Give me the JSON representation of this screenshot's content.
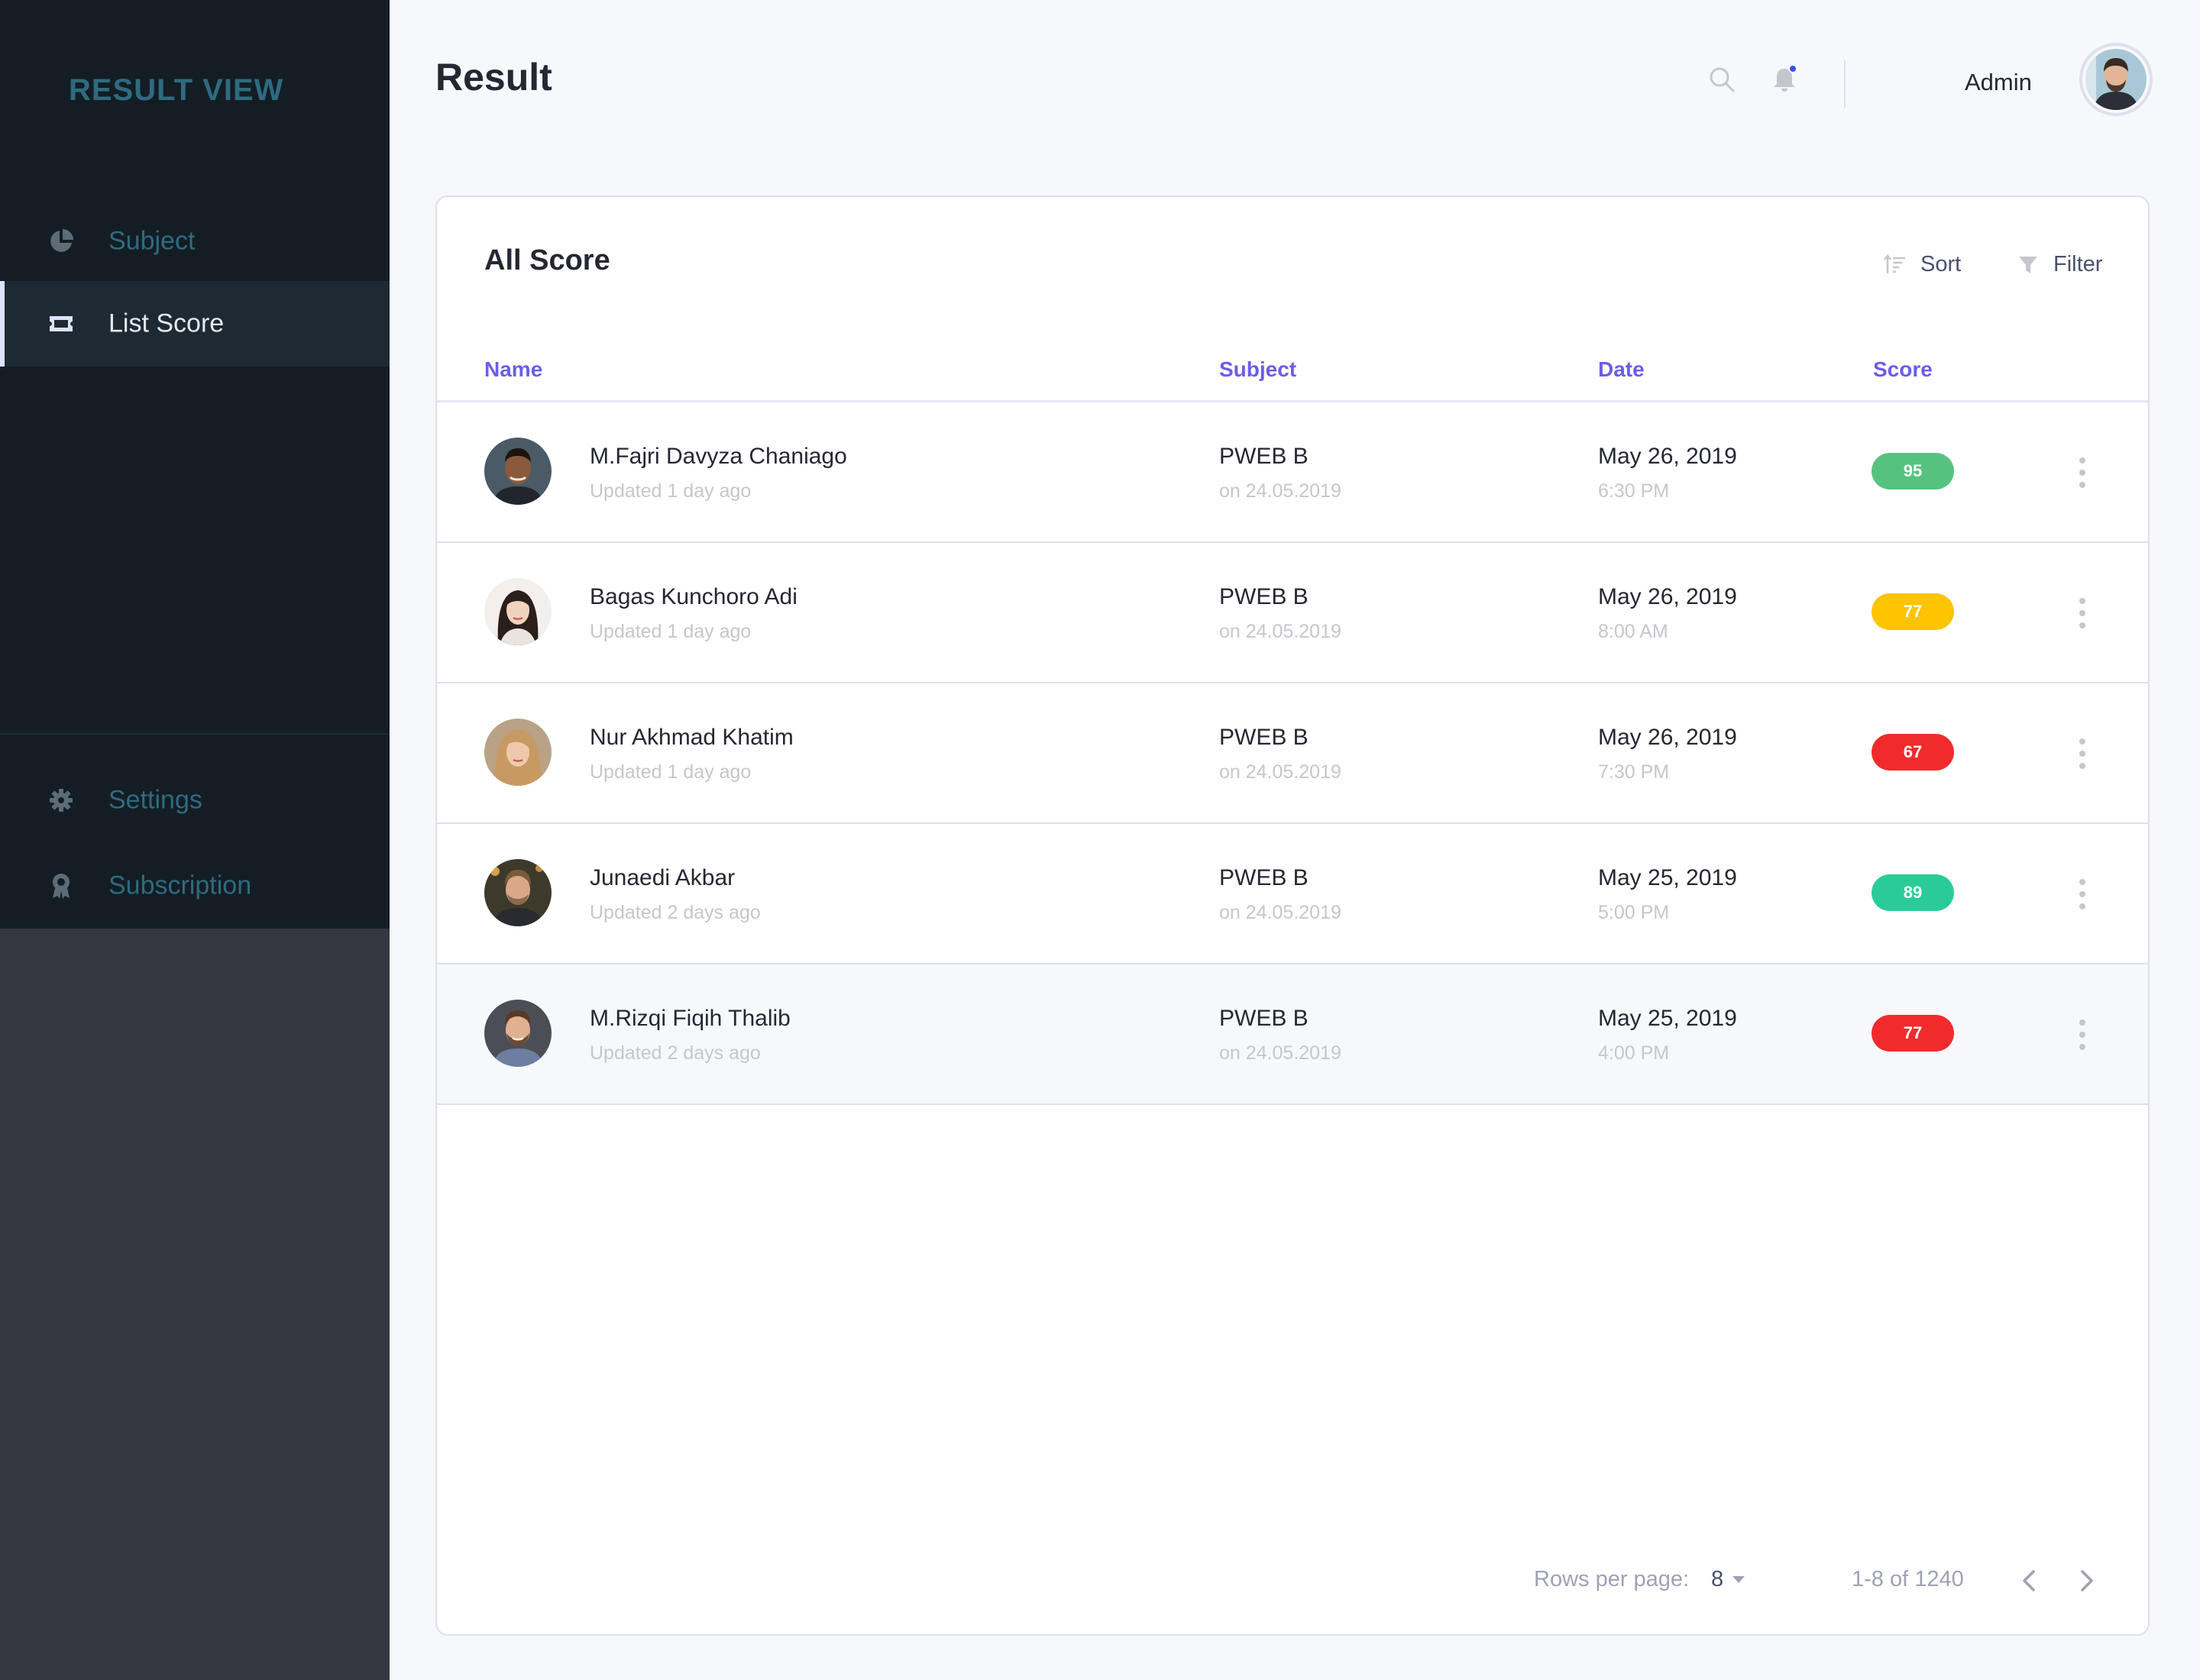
{
  "sidebar": {
    "brand": "RESULT VIEW",
    "items": [
      {
        "label": "Subject",
        "icon": "pie-chart-icon",
        "active": false
      },
      {
        "label": "List Score",
        "icon": "ticket-icon",
        "active": true
      },
      {
        "label": "Settings",
        "icon": "gear-icon",
        "active": false
      },
      {
        "label": "Subscription",
        "icon": "award-icon",
        "active": false
      }
    ]
  },
  "header": {
    "title": "Result",
    "user_name": "Admin",
    "icons": [
      "search-icon",
      "bell-icon"
    ]
  },
  "card": {
    "title": "All Score",
    "sort_label": "Sort",
    "filter_label": "Filter",
    "columns": [
      "Name",
      "Subject",
      "Date",
      "Score"
    ],
    "rows": [
      {
        "name": "M.Fajri Davyza Chaniago",
        "updated": "Updated 1 day ago",
        "subject": "PWEB B",
        "subject_date": "on 24.05.2019",
        "date": "May 26, 2019",
        "time": "6:30 PM",
        "score": "95",
        "score_color": "#57c27f"
      },
      {
        "name": "Bagas Kunchoro Adi",
        "updated": "Updated 1 day ago",
        "subject": "PWEB B",
        "subject_date": "on 24.05.2019",
        "date": "May 26, 2019",
        "time": "8:00 AM",
        "score": "77",
        "score_color": "#fec400"
      },
      {
        "name": "Nur Akhmad Khatim",
        "updated": "Updated 1 day ago",
        "subject": "PWEB B",
        "subject_date": "on 24.05.2019",
        "date": "May 26, 2019",
        "time": "7:30 PM",
        "score": "67",
        "score_color": "#f12b2c"
      },
      {
        "name": "Junaedi Akbar",
        "updated": "Updated 2 days ago",
        "subject": "PWEB B",
        "subject_date": "on 24.05.2019",
        "date": "May 25, 2019",
        "time": "5:00 PM",
        "score": "89",
        "score_color": "#29cc97"
      },
      {
        "name": "M.Rizqi Fiqih Thalib",
        "updated": "Updated 2 days ago",
        "subject": "PWEB B",
        "subject_date": "on 24.05.2019",
        "date": "May 25, 2019",
        "time": "4:00 PM",
        "score": "77",
        "score_color": "#f12b2c"
      }
    ]
  },
  "pagination": {
    "rows_label": "Rows per page:",
    "rows_value": "8",
    "range": "1-8 of 1240"
  },
  "colors": {
    "sidebar_dark": "#141d24",
    "sidebar_accent": "#2e6b80",
    "column_header": "#6a5ee8",
    "notification_dot": "#3751ff"
  }
}
